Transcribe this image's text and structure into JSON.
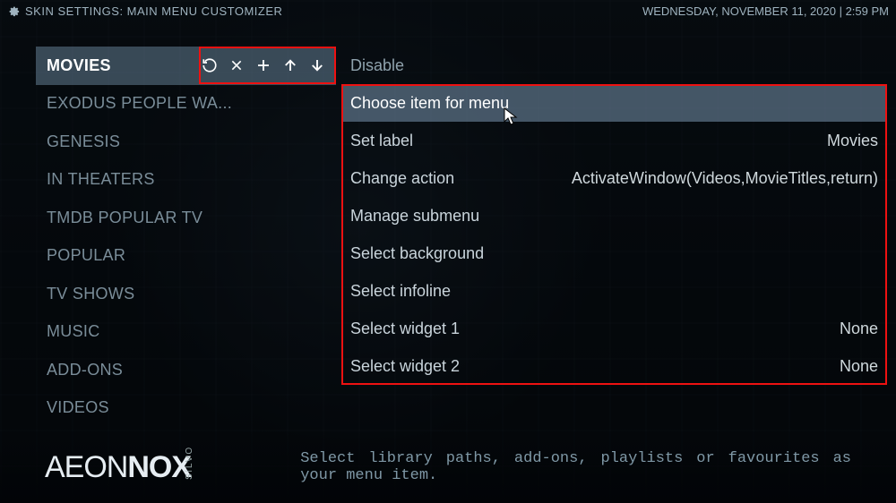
{
  "header": {
    "title": "SKIN SETTINGS: MAIN MENU CUSTOMIZER",
    "datetime": "WEDNESDAY, NOVEMBER 11, 2020 | 2:59 PM"
  },
  "sidebar": {
    "items": [
      {
        "label": "MOVIES",
        "selected": true
      },
      {
        "label": "EXODUS PEOPLE WA..."
      },
      {
        "label": "GENESIS"
      },
      {
        "label": "IN THEATERS"
      },
      {
        "label": "TMDB POPULAR TV"
      },
      {
        "label": "POPULAR"
      },
      {
        "label": "TV SHOWS"
      },
      {
        "label": "MUSIC"
      },
      {
        "label": "ADD-ONS"
      },
      {
        "label": "VIDEOS"
      }
    ],
    "icon_tooltips": {
      "reset": "Reset",
      "remove": "Remove",
      "add": "Add",
      "move_up": "Move up",
      "move_down": "Move down"
    }
  },
  "content": {
    "disable": "Disable",
    "rows": [
      {
        "l": "Choose item for menu",
        "r": "",
        "highlight": true
      },
      {
        "l": "Set label",
        "r": "Movies"
      },
      {
        "l": "Change action",
        "r": "ActivateWindow(Videos,MovieTitles,return)"
      },
      {
        "l": "Manage submenu",
        "r": ""
      },
      {
        "l": "Select background",
        "r": ""
      },
      {
        "l": "Select infoline",
        "r": ""
      },
      {
        "l": "Select widget 1",
        "r": "None"
      },
      {
        "l": "Select widget 2",
        "r": "None"
      }
    ]
  },
  "footer": {
    "logo_a": "AEON ",
    "logo_b": "NOX",
    "logo_sub": "SiLVO",
    "hint": "Select library paths, add-ons, playlists or favourites as your menu item."
  }
}
